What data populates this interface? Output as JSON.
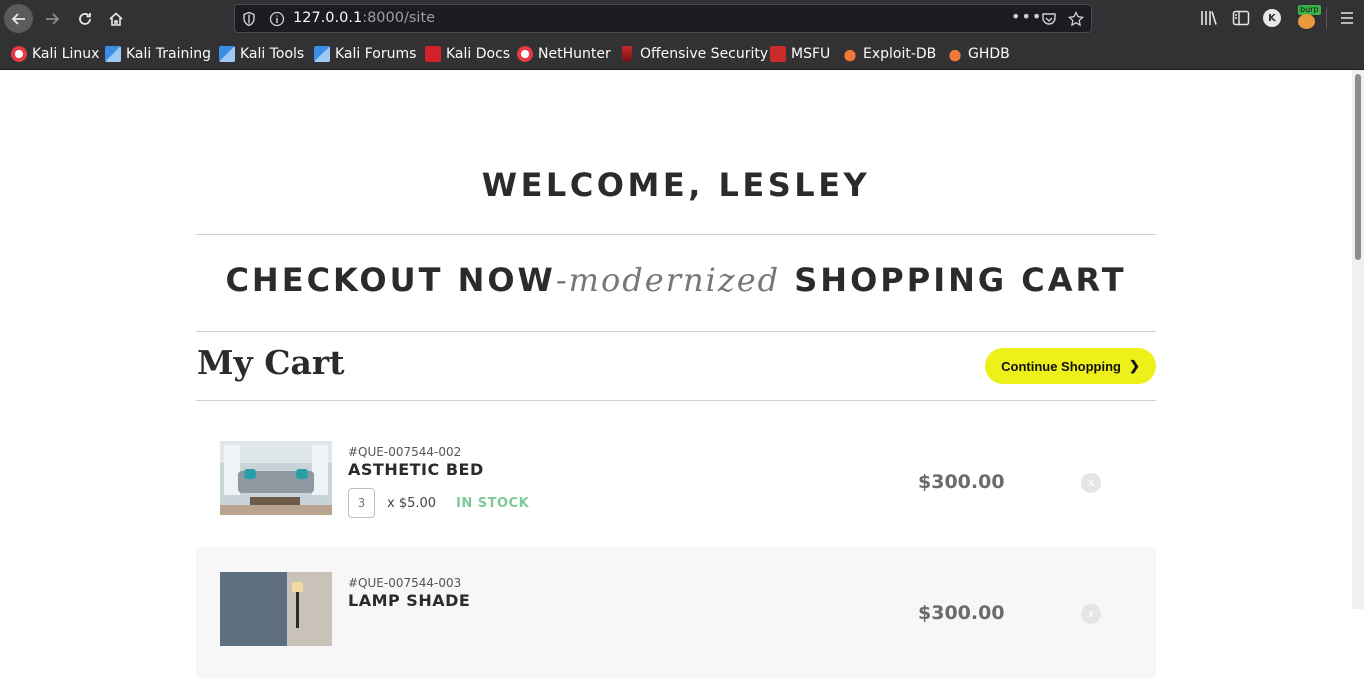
{
  "browser": {
    "url_host": "127.0.0.1",
    "url_rest": ":8000/site",
    "profile_initial": "K",
    "burp_tag": "burp",
    "bookmarks": [
      {
        "label": "Kali Linux",
        "icon": "kali-icon"
      },
      {
        "label": "Kali Training",
        "icon": "kali-dragon-icon"
      },
      {
        "label": "Kali Tools",
        "icon": "kali-dragon-icon"
      },
      {
        "label": "Kali Forums",
        "icon": "kali-dragon-icon"
      },
      {
        "label": "Kali Docs",
        "icon": "kali-docs-icon"
      },
      {
        "label": "NetHunter",
        "icon": "kali-icon"
      },
      {
        "label": "Offensive Security",
        "icon": "offsec-icon"
      },
      {
        "label": "MSFU",
        "icon": "msfu-icon"
      },
      {
        "label": "Exploit-DB",
        "icon": "exploit-db-icon"
      },
      {
        "label": "GHDB",
        "icon": "ghdb-icon"
      }
    ]
  },
  "page": {
    "welcome": "WELCOME, LESLEY",
    "headline_left": "CHECKOUT NOW",
    "headline_italic": "-modernized",
    "headline_right": " SHOPPING CART",
    "cart_title": "My Cart",
    "continue_label": "Continue Shopping",
    "continue_arrow": "❯"
  },
  "cart": {
    "items": [
      {
        "sku": "#QUE-007544-002",
        "name": "ASTHETIC BED",
        "qty": "3",
        "unit_price": "x $5.00",
        "stock": "IN STOCK",
        "price": "$300.00",
        "remove": "x"
      },
      {
        "sku": "#QUE-007544-003",
        "name": "LAMP SHADE",
        "price": "$300.00",
        "remove": "x"
      }
    ]
  },
  "colors": {
    "accent_button": "#eef019",
    "in_stock": "#7ec89a",
    "browser_chrome": "#323234"
  }
}
